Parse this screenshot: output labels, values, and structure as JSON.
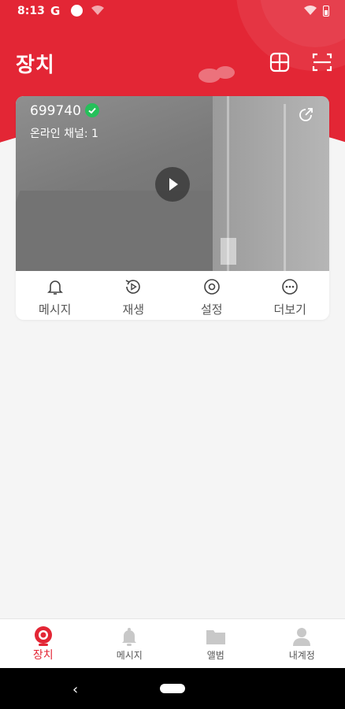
{
  "status": {
    "time": "8:13",
    "g": "G"
  },
  "header": {
    "title": "장치"
  },
  "device": {
    "name": "699740",
    "channel_text": "온라인 채널: 1",
    "actions": [
      {
        "label": "메시지",
        "icon": "bell-icon"
      },
      {
        "label": "재생",
        "icon": "replay-icon"
      },
      {
        "label": "설정",
        "icon": "settings-icon"
      },
      {
        "label": "더보기",
        "icon": "more-icon"
      }
    ]
  },
  "bottom_nav": [
    {
      "label": "장치",
      "icon": "camera-icon",
      "active": true
    },
    {
      "label": "메시지",
      "icon": "bell-icon"
    },
    {
      "label": "앨범",
      "icon": "folder-icon"
    },
    {
      "label": "내계정",
      "icon": "user-icon"
    }
  ],
  "colors": {
    "accent": "#e32635",
    "online": "#25c05a"
  }
}
